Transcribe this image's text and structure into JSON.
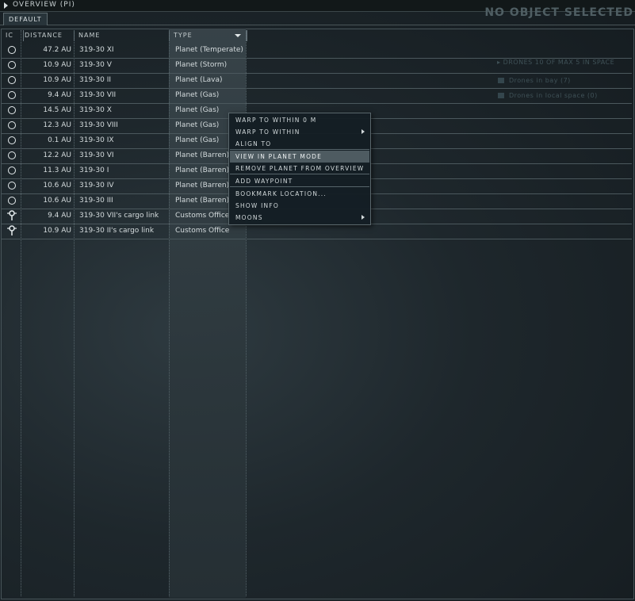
{
  "window": {
    "title": "OVERVIEW (PI)",
    "status": "NO OBJECT SELECTED"
  },
  "tabs": [
    {
      "label": "DEFAULT",
      "active": true
    }
  ],
  "columns": [
    {
      "label": "IC"
    },
    {
      "label": "DISTANCE"
    },
    {
      "label": "NAME"
    },
    {
      "label": "TYPE",
      "sorted": true
    }
  ],
  "rows": [
    {
      "icon": "planet-icon",
      "distance": "47.2 AU",
      "name": "319-30 XI",
      "type": "Planet (Temperate)"
    },
    {
      "icon": "planet-icon",
      "distance": "10.9 AU",
      "name": "319-30 V",
      "type": "Planet (Storm)"
    },
    {
      "icon": "planet-icon",
      "distance": "10.9 AU",
      "name": "319-30 II",
      "type": "Planet (Lava)"
    },
    {
      "icon": "planet-icon",
      "distance": "9.4 AU",
      "name": "319-30 VII",
      "type": "Planet (Gas)"
    },
    {
      "icon": "planet-icon",
      "distance": "14.5 AU",
      "name": "319-30 X",
      "type": "Planet (Gas)"
    },
    {
      "icon": "planet-icon",
      "distance": "12.3 AU",
      "name": "319-30 VIII",
      "type": "Planet (Gas)"
    },
    {
      "icon": "planet-icon",
      "distance": "0.1 AU",
      "name": "319-30 IX",
      "type": "Planet (Gas)"
    },
    {
      "icon": "planet-icon",
      "distance": "12.2 AU",
      "name": "319-30 VI",
      "type": "Planet (Barren)"
    },
    {
      "icon": "planet-icon",
      "distance": "11.3 AU",
      "name": "319-30 I",
      "type": "Planet (Barren)"
    },
    {
      "icon": "planet-icon",
      "distance": "10.6 AU",
      "name": "319-30 IV",
      "type": "Planet (Barren)"
    },
    {
      "icon": "planet-icon",
      "distance": "10.6 AU",
      "name": "319-30 III",
      "type": "Planet (Barren)"
    },
    {
      "icon": "customs-office-icon",
      "distance": "9.4 AU",
      "name": "319-30 VII's cargo link",
      "type": "Customs Office"
    },
    {
      "icon": "customs-office-icon",
      "distance": "10.9 AU",
      "name": "319-30 II's cargo link",
      "type": "Customs Office"
    }
  ],
  "context_menu": {
    "items": [
      {
        "label": "WARP TO WITHIN 0 M",
        "submenu": false,
        "highlighted": false
      },
      {
        "label": "WARP TO WITHIN",
        "submenu": true,
        "highlighted": false
      },
      {
        "label": "ALIGN TO",
        "submenu": false,
        "highlighted": false
      },
      {
        "label": "VIEW IN PLANET MODE",
        "submenu": false,
        "highlighted": true
      },
      {
        "label": "REMOVE PLANET FROM OVERVIEW",
        "submenu": false,
        "highlighted": false
      },
      {
        "label": "ADD WAYPOINT",
        "submenu": false,
        "highlighted": false
      },
      {
        "label": "BOOKMARK LOCATION...",
        "submenu": false,
        "highlighted": false
      },
      {
        "label": "SHOW INFO",
        "submenu": false,
        "highlighted": false
      },
      {
        "label": "MOONS",
        "submenu": true,
        "highlighted": false
      }
    ]
  },
  "background_drones": {
    "header": "DRONES 10 OF MAX 5 IN SPACE",
    "bay": "Drones in bay (7)",
    "space": "Drones in local space (0)"
  },
  "colors": {
    "background": "#1e272c",
    "highlight": "#4e5b61",
    "text": "#d4dbdd"
  }
}
